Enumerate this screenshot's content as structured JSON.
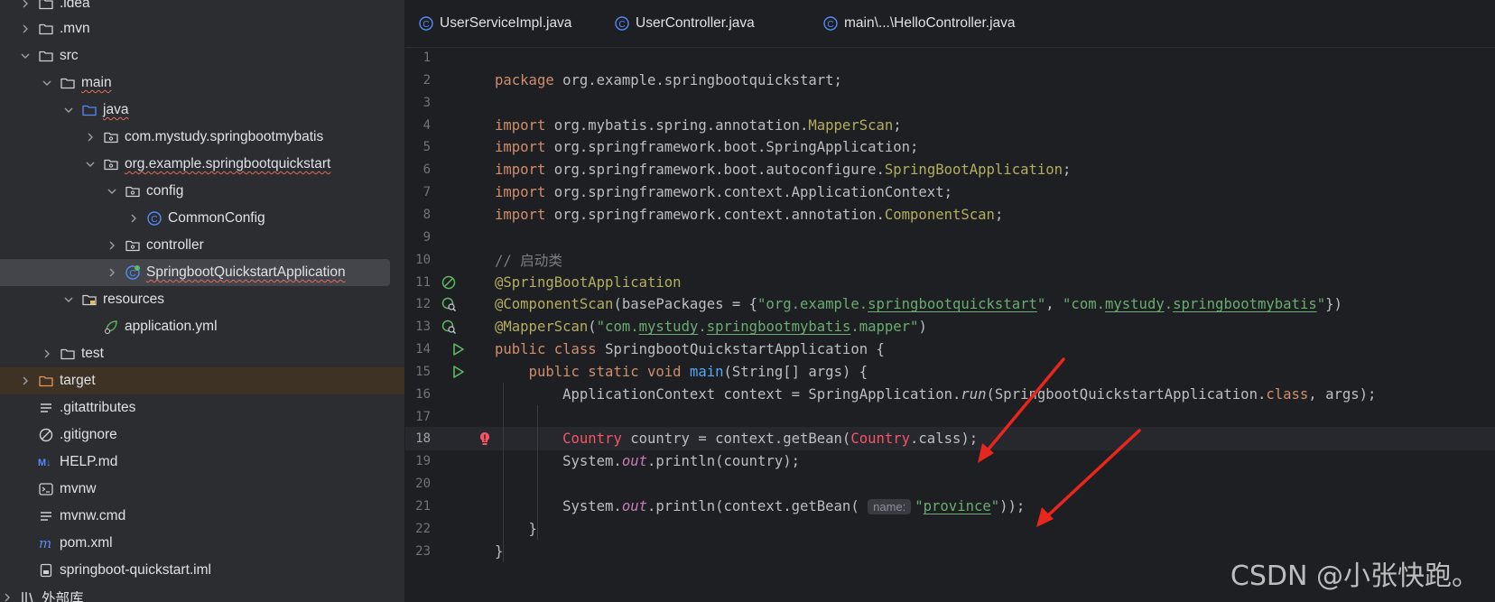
{
  "sidebar": {
    "items": [
      {
        "label": ".idea",
        "type": "folder",
        "expand": "collapsed"
      },
      {
        "label": ".mvn",
        "type": "folder",
        "expand": "collapsed"
      },
      {
        "label": "src",
        "type": "folder",
        "expand": "expanded"
      },
      {
        "label": "main",
        "type": "folder",
        "expand": "expanded"
      },
      {
        "label": "java",
        "type": "folder-source",
        "expand": "expanded"
      },
      {
        "label": "com.mystudy.springbootmybatis",
        "type": "package",
        "expand": "collapsed"
      },
      {
        "label": "org.example.springbootquickstart",
        "type": "package",
        "expand": "expanded"
      },
      {
        "label": "config",
        "type": "package",
        "expand": "expanded"
      },
      {
        "label": "CommonConfig",
        "type": "class",
        "expand": "collapsed"
      },
      {
        "label": "controller",
        "type": "package",
        "expand": "collapsed"
      },
      {
        "label": "SpringbootQuickstartApplication",
        "type": "spring-class",
        "expand": "collapsed"
      },
      {
        "label": "resources",
        "type": "folder-resources",
        "expand": "expanded"
      },
      {
        "label": "application.yml",
        "type": "yml",
        "expand": "none"
      },
      {
        "label": "test",
        "type": "folder",
        "expand": "collapsed"
      },
      {
        "label": "target",
        "type": "folder-excluded",
        "expand": "collapsed"
      },
      {
        "label": ".gitattributes",
        "type": "text",
        "expand": "none"
      },
      {
        "label": ".gitignore",
        "type": "ignore",
        "expand": "none"
      },
      {
        "label": "HELP.md",
        "type": "markdown",
        "expand": "none"
      },
      {
        "label": "mvnw",
        "type": "terminal",
        "expand": "none"
      },
      {
        "label": "mvnw.cmd",
        "type": "text",
        "expand": "none"
      },
      {
        "label": "pom.xml",
        "type": "maven",
        "expand": "none"
      },
      {
        "label": "springboot-quickstart.iml",
        "type": "iml",
        "expand": "none"
      },
      {
        "label": "外部库",
        "type": "library",
        "expand": "collapsed"
      }
    ]
  },
  "tabs": [
    {
      "label": "UserServiceImpl.java"
    },
    {
      "label": "UserController.java"
    },
    {
      "label": "main\\...\\HelloController.java"
    }
  ],
  "editor": {
    "current_line": 18,
    "lines": [
      {
        "n": "1",
        "tokens": []
      },
      {
        "n": "2",
        "tokens": [
          [
            "kw",
            "package "
          ],
          [
            "",
            "org.example.springbootquickstart;"
          ]
        ]
      },
      {
        "n": "3",
        "tokens": []
      },
      {
        "n": "4",
        "tokens": [
          [
            "kw",
            "import "
          ],
          [
            "",
            "org.mybatis.spring.annotation."
          ],
          [
            "ann",
            "MapperScan"
          ],
          [
            "",
            ";"
          ]
        ]
      },
      {
        "n": "5",
        "tokens": [
          [
            "kw",
            "import "
          ],
          [
            "",
            "org.springframework.boot.SpringApplication;"
          ]
        ]
      },
      {
        "n": "6",
        "tokens": [
          [
            "kw",
            "import "
          ],
          [
            "",
            "org.springframework.boot.autoconfigure."
          ],
          [
            "ann",
            "SpringBootApplication"
          ],
          [
            "",
            ";"
          ]
        ]
      },
      {
        "n": "7",
        "tokens": [
          [
            "kw",
            "import "
          ],
          [
            "",
            "org.springframework.context.ApplicationContext;"
          ]
        ]
      },
      {
        "n": "8",
        "tokens": [
          [
            "kw",
            "import "
          ],
          [
            "",
            "org.springframework.context.annotation."
          ],
          [
            "ann",
            "ComponentScan"
          ],
          [
            "",
            ";"
          ]
        ]
      },
      {
        "n": "9",
        "tokens": []
      },
      {
        "n": "10",
        "tokens": [
          [
            "cmt",
            "// 启动类"
          ]
        ]
      },
      {
        "n": "11",
        "gutter": "bean-icon",
        "tokens": [
          [
            "ann",
            "@SpringBootApplication"
          ]
        ]
      },
      {
        "n": "12",
        "gutter": "bean-search-icon",
        "tokens": [
          [
            "ann",
            "@ComponentScan"
          ],
          [
            "",
            "(basePackages = {"
          ],
          [
            "str",
            "\"org.example."
          ],
          [
            "str und",
            "springbootquickstart"
          ],
          [
            "str",
            "\""
          ],
          [
            "",
            ", "
          ],
          [
            "str",
            "\"com."
          ],
          [
            "str und",
            "mystudy"
          ],
          [
            "str",
            "."
          ],
          [
            "str und",
            "springbootmybatis"
          ],
          [
            "str",
            "\""
          ],
          [
            "",
            "})"
          ]
        ]
      },
      {
        "n": "13",
        "gutter": "bean-search-icon",
        "tokens": [
          [
            "ann",
            "@MapperScan"
          ],
          [
            "",
            "("
          ],
          [
            "str",
            "\"com."
          ],
          [
            "str und",
            "mystudy"
          ],
          [
            "str",
            "."
          ],
          [
            "str und",
            "springbootmybatis"
          ],
          [
            "str",
            ".mapper\""
          ],
          [
            "",
            ")"
          ]
        ]
      },
      {
        "n": "14",
        "gutter": "run-icon",
        "tokens": [
          [
            "kw",
            "public class "
          ],
          [
            "",
            "SpringbootQuickstartApplication {"
          ]
        ]
      },
      {
        "n": "15",
        "gutter": "run-icon",
        "tokens": [
          [
            "",
            "    "
          ],
          [
            "kw",
            "public static void "
          ],
          [
            "fn",
            "main"
          ],
          [
            "",
            "(String[] args) {"
          ]
        ]
      },
      {
        "n": "16",
        "tokens": [
          [
            "",
            "        ApplicationContext context = SpringApplication."
          ],
          [
            "itl",
            "run"
          ],
          [
            "",
            "(SpringbootQuickstartApplication."
          ],
          [
            "kw",
            "class"
          ],
          [
            "",
            ", args);"
          ]
        ]
      },
      {
        "n": "17",
        "tokens": []
      },
      {
        "n": "18",
        "gutter": "error-bulb-icon",
        "tokens": [
          [
            "",
            "        "
          ],
          [
            "err",
            "Country"
          ],
          [
            "",
            " country = context.getBean("
          ],
          [
            "err",
            "Country"
          ],
          [
            "",
            ".calss);"
          ]
        ]
      },
      {
        "n": "19",
        "tokens": [
          [
            "",
            "        System."
          ],
          [
            "fld",
            "out"
          ],
          [
            "",
            ".println(country);"
          ]
        ]
      },
      {
        "n": "20",
        "tokens": []
      },
      {
        "n": "21",
        "tokens": [
          [
            "",
            "        System."
          ],
          [
            "fld",
            "out"
          ],
          [
            "",
            ".println(context.getBean( "
          ],
          [
            "hint",
            "name:"
          ],
          [
            "str",
            "\""
          ],
          [
            "str und",
            "province"
          ],
          [
            "str",
            "\""
          ],
          [
            "",
            "));"
          ]
        ]
      },
      {
        "n": "22",
        "tokens": [
          [
            "",
            "    }"
          ]
        ]
      },
      {
        "n": "23",
        "tokens": [
          [
            "",
            "}"
          ]
        ]
      }
    ]
  },
  "watermark": "CSDN @小张快跑。",
  "colors": {
    "arrow": "#e8261e",
    "accent": "#548af7"
  }
}
